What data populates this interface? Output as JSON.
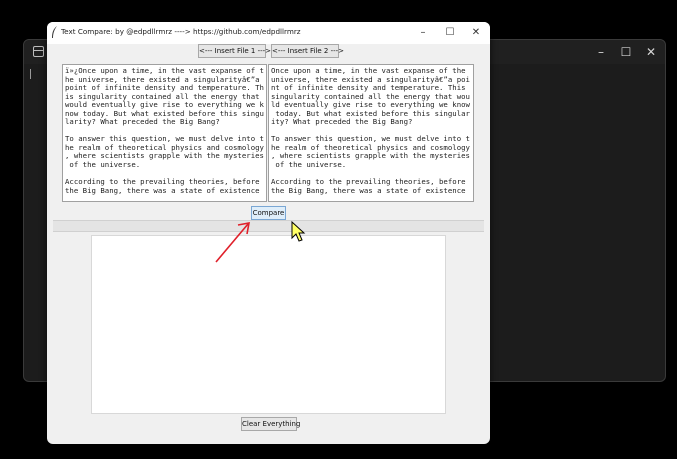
{
  "background_window": {
    "minimize_icon": "minimize-icon",
    "maximize_icon": "maximize-icon",
    "close_icon": "close-icon"
  },
  "window": {
    "title": "Text Compare: by @edpdllrmrz ----> https://github.com/edpdllrmrz",
    "minimize": "–",
    "maximize": "☐",
    "close": "✕"
  },
  "buttons": {
    "insert_file_1": "<--- Insert File 1 --->",
    "insert_file_2": "<--- Insert File 2 --->",
    "compare": "Compare",
    "clear": "Clear Everything"
  },
  "text_left": "ï»¿Once upon a time, in the vast expanse of t\nhe universe, there existed a singularityâ€”a\npoint of infinite density and temperature. Th\nis singularity contained all the energy that\nwould eventually give rise to everything we k\nnow today. But what existed before this singu\nlarity? What preceded the Big Bang?\n\nTo answer this question, we must delve into t\nhe realm of theoretical physics and cosmology\n, where scientists grapple with the mysteries\n of the universe.\n\nAccording to the prevailing theories, before\nthe Big Bang, there was a state of existence",
  "text_right": "Once upon a time, in the vast expanse of the\nuniverse, there existed a singularityâ€”a poi\nnt of infinite density and temperature. This\nsingularity contained all the energy that wou\nld eventually give rise to everything we know\n today. But what existed before this singular\nity? What preceded the Big Bang?\n\nTo answer this question, we must delve into t\nhe realm of theoretical physics and cosmology\n, where scientists grapple with the mysteries\n of the universe.\n\nAccording to the prevailing theories, before\nthe Big Bang, there was a state of existence",
  "output_text": "",
  "colors": {
    "arrow": "#e0202a",
    "compare_button": "#dfeefa"
  }
}
